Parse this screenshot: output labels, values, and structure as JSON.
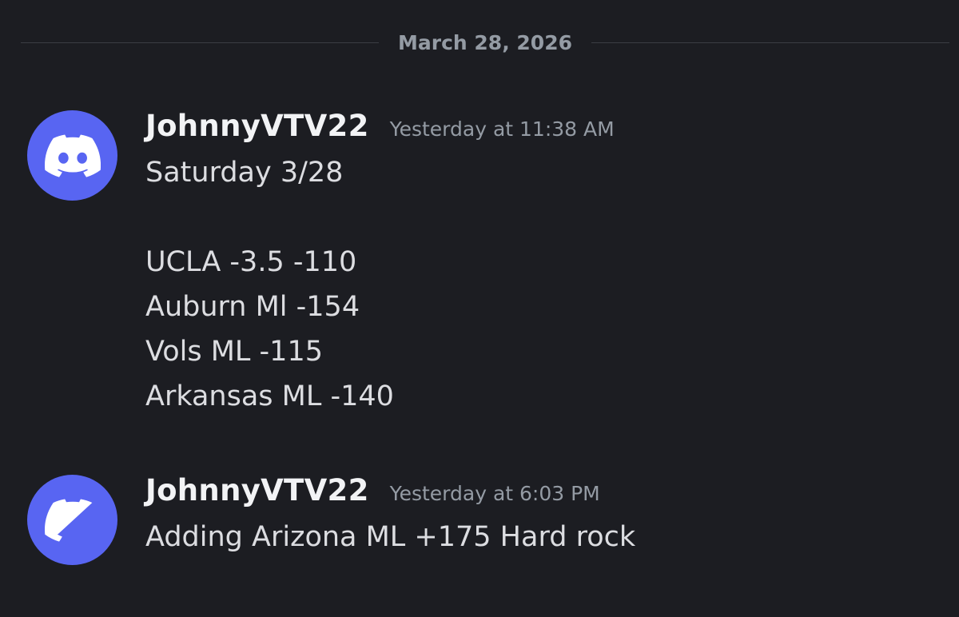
{
  "date_divider": "March 28, 2026",
  "messages": [
    {
      "author": "JohnnyVTV22",
      "timestamp": "Yesterday at 11:38 AM",
      "avatar_icon": "discord-logo-icon",
      "lines": [
        "Saturday 3/28",
        "",
        "UCLA -3.5 -110",
        "Auburn Ml -154",
        "Vols ML -115",
        "Arkansas ML -140"
      ]
    },
    {
      "author": "JohnnyVTV22",
      "timestamp": "Yesterday at 6:03 PM",
      "avatar_icon": "discord-logo-icon",
      "lines": [
        "Adding Arizona ML +175 Hard rock"
      ]
    }
  ],
  "colors": {
    "background": "#1c1d22",
    "avatar": "#5865f2",
    "username": "#f2f3f5",
    "timestamp": "#949ba4",
    "text": "#dcdde1"
  }
}
